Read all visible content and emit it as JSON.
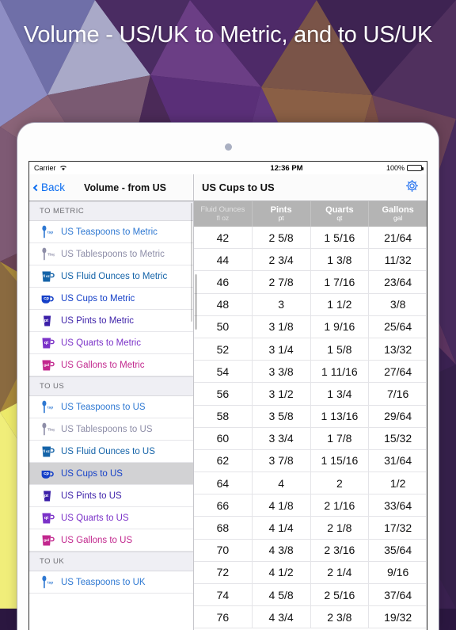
{
  "promo": {
    "title": "Volume - US/UK to Metric, and to US/UK",
    "background_colors": [
      "#3a2150",
      "#4b2a6b",
      "#8a6a4a",
      "#6e5a78",
      "#2b1740",
      "#7b6ea8",
      "#8c5a52"
    ]
  },
  "device": {
    "camera_dot": "camera-dot",
    "frame_color": "#fdfdfd"
  },
  "status_bar": {
    "carrier": "Carrier",
    "wifi": "wifi-icon",
    "time": "12:36 PM",
    "battery_percent": "100%",
    "battery": "battery-full-icon"
  },
  "nav_bar": {
    "back_label": "Back",
    "back_icon": "chevron-left-icon",
    "left_title": "Volume - from US",
    "right_title": "US Cups to US",
    "settings_icon": "gear-icon",
    "tint_color": "#0b6cf0"
  },
  "sidebar": {
    "sections": [
      {
        "header": "TO METRIC",
        "items": [
          {
            "label": "US Teaspoons to Metric",
            "unit": "tsp",
            "icon": "teaspoon-icon",
            "color": "#2e78d2",
            "shape": "spoon",
            "selected": false
          },
          {
            "label": "US Tablespoons to Metric",
            "unit": "Tbsp",
            "icon": "tablespoon-icon",
            "color": "#8e8ea8",
            "shape": "spoon",
            "selected": false
          },
          {
            "label": "US Fluid Ounces to Metric",
            "unit": "fl oz",
            "icon": "fluid-ounce-icon",
            "color": "#1463a8",
            "shape": "jug",
            "selected": false
          },
          {
            "label": "US Cups to Metric",
            "unit": "cp",
            "icon": "cup-icon",
            "color": "#1540c8",
            "shape": "cup",
            "selected": false
          },
          {
            "label": "US Pints to Metric",
            "unit": "pt",
            "icon": "pint-icon",
            "color": "#3b1fa8",
            "shape": "glass",
            "selected": false
          },
          {
            "label": "US Quarts to Metric",
            "unit": "qt",
            "icon": "quart-icon",
            "color": "#7b32c8",
            "shape": "jug",
            "selected": false
          },
          {
            "label": "US Gallons to Metric",
            "unit": "gal",
            "icon": "gallon-icon",
            "color": "#c2288e",
            "shape": "jug",
            "selected": false
          }
        ]
      },
      {
        "header": "TO US",
        "items": [
          {
            "label": "US Teaspoons to US",
            "unit": "tsp",
            "icon": "teaspoon-icon",
            "color": "#2e78d2",
            "shape": "spoon",
            "selected": false
          },
          {
            "label": "US Tablespoons to US",
            "unit": "Tbsp",
            "icon": "tablespoon-icon",
            "color": "#8e8ea8",
            "shape": "spoon",
            "selected": false
          },
          {
            "label": "US Fluid Ounces to US",
            "unit": "fl oz",
            "icon": "fluid-ounce-icon",
            "color": "#1463a8",
            "shape": "jug",
            "selected": false
          },
          {
            "label": "US Cups to US",
            "unit": "cp",
            "icon": "cup-icon",
            "color": "#1540c8",
            "shape": "cup",
            "selected": true
          },
          {
            "label": "US Pints to US",
            "unit": "pt",
            "icon": "pint-icon",
            "color": "#3b1fa8",
            "shape": "glass",
            "selected": false
          },
          {
            "label": "US Quarts to US",
            "unit": "qt",
            "icon": "quart-icon",
            "color": "#7b32c8",
            "shape": "jug",
            "selected": false
          },
          {
            "label": "US Gallons to US",
            "unit": "gal",
            "icon": "gallon-icon",
            "color": "#c2288e",
            "shape": "jug",
            "selected": false
          }
        ]
      },
      {
        "header": "TO UK",
        "items": [
          {
            "label": "US Teaspoons to UK",
            "unit": "tsp",
            "icon": "teaspoon-icon",
            "color": "#2e78d2",
            "shape": "spoon",
            "selected": false
          }
        ]
      }
    ]
  },
  "table": {
    "columns": [
      {
        "name": "Fluid Ounces",
        "abbr": "fl oz",
        "muted": true
      },
      {
        "name": "Pints",
        "abbr": "pt",
        "muted": false
      },
      {
        "name": "Quarts",
        "abbr": "qt",
        "muted": false
      },
      {
        "name": "Gallons",
        "abbr": "gal",
        "muted": false
      }
    ],
    "rows": [
      [
        "42",
        "2 5/8",
        "1 5/16",
        "21/64"
      ],
      [
        "44",
        "2 3/4",
        "1 3/8",
        "11/32"
      ],
      [
        "46",
        "2 7/8",
        "1 7/16",
        "23/64"
      ],
      [
        "48",
        "3",
        "1 1/2",
        "3/8"
      ],
      [
        "50",
        "3 1/8",
        "1 9/16",
        "25/64"
      ],
      [
        "52",
        "3 1/4",
        "1 5/8",
        "13/32"
      ],
      [
        "54",
        "3 3/8",
        "1 11/16",
        "27/64"
      ],
      [
        "56",
        "3 1/2",
        "1 3/4",
        "7/16"
      ],
      [
        "58",
        "3 5/8",
        "1 13/16",
        "29/64"
      ],
      [
        "60",
        "3 3/4",
        "1 7/8",
        "15/32"
      ],
      [
        "62",
        "3 7/8",
        "1 15/16",
        "31/64"
      ],
      [
        "64",
        "4",
        "2",
        "1/2"
      ],
      [
        "66",
        "4 1/8",
        "2 1/16",
        "33/64"
      ],
      [
        "68",
        "4 1/4",
        "2 1/8",
        "17/32"
      ],
      [
        "70",
        "4 3/8",
        "2 3/16",
        "35/64"
      ],
      [
        "72",
        "4 1/2",
        "2 1/4",
        "9/16"
      ],
      [
        "74",
        "4 5/8",
        "2 5/16",
        "37/64"
      ],
      [
        "76",
        "4 3/4",
        "2 3/8",
        "19/32"
      ]
    ]
  }
}
